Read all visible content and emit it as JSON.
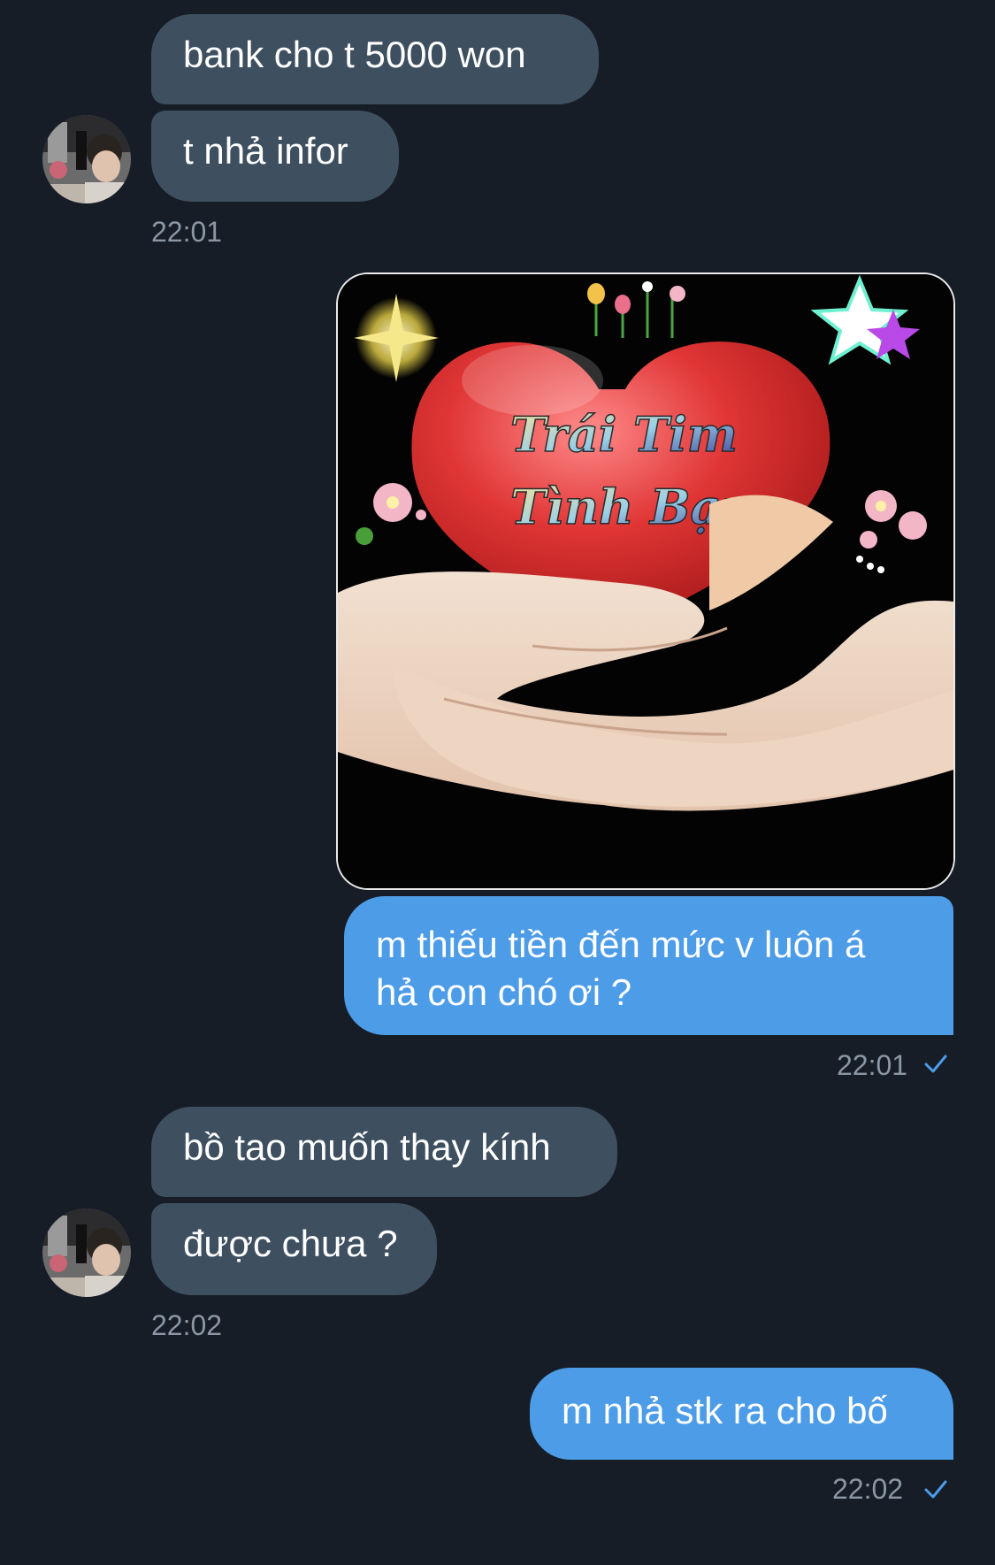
{
  "messages": {
    "m1": "bank cho t 5000 won",
    "m2": "t nhả infor",
    "t1": "22:01",
    "image_caption_line1": "Trái Tim",
    "image_caption_line2": "Tình Bạn",
    "m3_line1": "m thiếu tiền đến mức v luôn á",
    "m3_line2": "hả con chó ơi ?",
    "t2": "22:01",
    "m4": "bồ tao muốn thay kính",
    "m5": "được chưa ?",
    "t3": "22:02",
    "m6": "m nhả stk ra cho bố",
    "t4": "22:02"
  },
  "icons": {
    "read_check": "check-icon",
    "avatar": "contact-avatar"
  },
  "colors": {
    "background": "#161d27",
    "incoming_bubble": "#3e4f60",
    "outgoing_bubble": "#4c9ce7",
    "timestamp": "#8b97a5",
    "check": "#4c9ce7"
  }
}
